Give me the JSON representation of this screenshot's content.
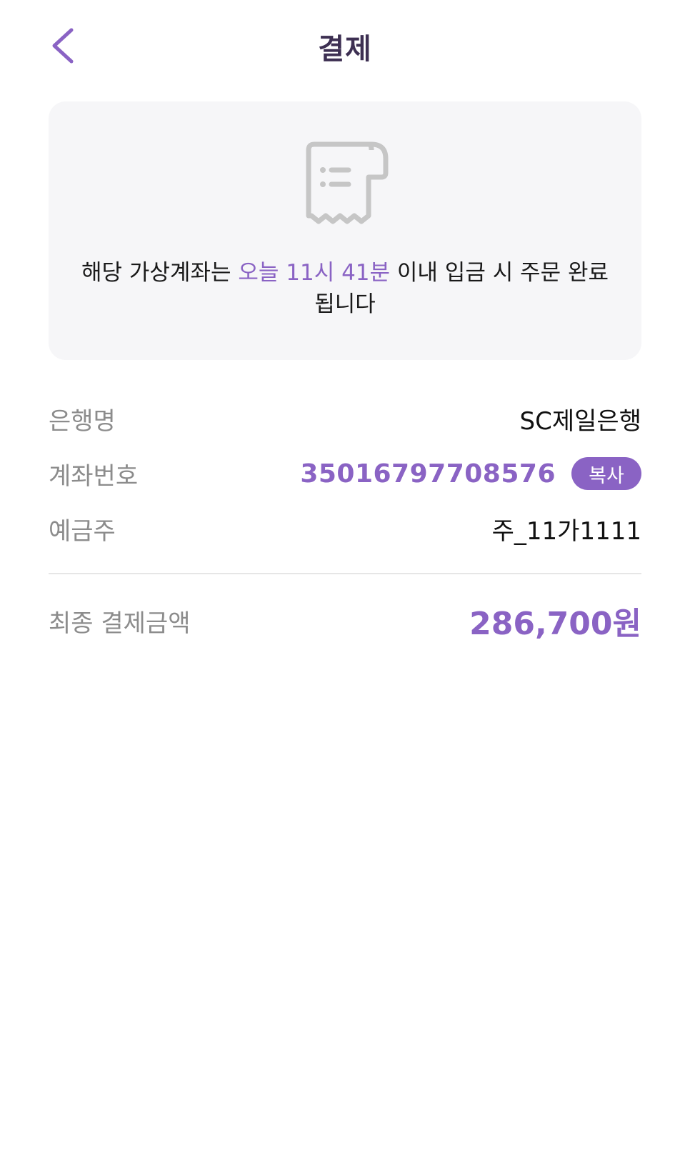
{
  "header": {
    "title": "결제",
    "back_icon": "chevron-left-icon"
  },
  "notice": {
    "icon": "receipt-icon",
    "text_before": "해당 가상계좌는 ",
    "highlight": "오늘 11시 41분",
    "text_after": " 이내 입금 시 주문 완료 됩니다"
  },
  "account": {
    "bank_label": "은행명",
    "bank_value": "SC제일은행",
    "number_label": "계좌번호",
    "number_value": "35016797708576",
    "copy_label": "복사",
    "holder_label": "예금주",
    "holder_value": "주_11가1111"
  },
  "total": {
    "label": "최종 결제금액",
    "amount": "286,700원"
  },
  "colors": {
    "accent": "#8a63c4",
    "title": "#3d2f52",
    "card_bg": "#f6f6f8",
    "label_gray": "#8c8c8c"
  }
}
